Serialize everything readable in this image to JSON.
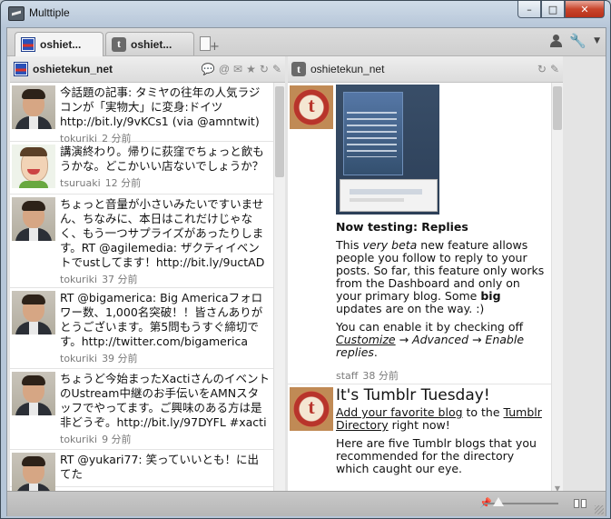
{
  "window": {
    "title": "Multtiple",
    "minimize": "–",
    "maximize": "□",
    "close": "✕"
  },
  "tabs": [
    {
      "label": "oshiet...",
      "icon": "oshietekun-icon",
      "active": true
    },
    {
      "label": "oshiet...",
      "icon": "tumblr-icon",
      "active": false
    }
  ],
  "column1": {
    "title": "oshietekun_net",
    "footer": {
      "close": "✕",
      "forward": "➜"
    },
    "items": [
      {
        "text": "今話題の記事: タミヤの往年の人気ラジコンが「実物大」に変身:ドイツ http://bit.ly/9vKCs1 (via @amntwit)",
        "user": "tokuriki",
        "time": "2 分前",
        "avatar": "person"
      },
      {
        "text": "講演終わり。帰りに荻窪でちょっと飲もうかな。どこかいい店ないでしょうか？",
        "user": "tsuruaki",
        "time": "12 分前",
        "avatar": "mii"
      },
      {
        "text": "ちょっと音量が小さいみたいですいません、ちなみに、本日はこれだけじゃなく、もう一つサプライズがあったりします。RT @agilemedia: ザクティイベントでustしてます！http://bit.ly/9uctAD",
        "user": "tokuriki",
        "time": "37 分前",
        "avatar": "person"
      },
      {
        "text": "RT @bigamerica: Big Americaフォロワー数、1,000名突破！！皆さんありがとうございます。第5問もうすぐ締切です。http://twitter.com/bigamerica",
        "user": "tokuriki",
        "time": "39 分前",
        "avatar": "person"
      },
      {
        "text": "ちょうど今始まったXactiさんのイベントのUstream中継のお手伝いをAMNスタッフでやってます。ご興味のある方は是非どうぞ。http://bit.ly/97DYFL #xacti",
        "user": "tokuriki",
        "time": "9 分前",
        "avatar": "person"
      },
      {
        "text": "RT @yukari77: 笑っていいとも！に出てた",
        "user": "",
        "time": "",
        "avatar": "person"
      }
    ]
  },
  "column2": {
    "title": "oshietekun_net",
    "footer": {
      "back": "⇠",
      "close": "✕"
    },
    "post1": {
      "heading": "Now testing: Replies",
      "p1_a": "This ",
      "p1_em": "very beta",
      "p1_b": " new feature allows people you follow to reply to your posts. So far, this feature only works from the Dashboard and only on your primary blog. Some ",
      "p1_strong": "big",
      "p1_c": " updates are on the way. :)",
      "p2_a": "You can enable it by checking off ",
      "p2_link": "Customize",
      "p2_b": " → Advanced → Enable replies",
      "p2_c": ".",
      "user": "staff",
      "time": "38 分前"
    },
    "post2": {
      "heading": "It's Tumblr Tuesday!",
      "link1": "Add your favorite blog",
      "mid": " to the ",
      "link2": "Tumblr Directory",
      "tail": " right now!",
      "p": "Here are five Tumblr blogs that you recommended for the directory which caught our eye."
    }
  }
}
